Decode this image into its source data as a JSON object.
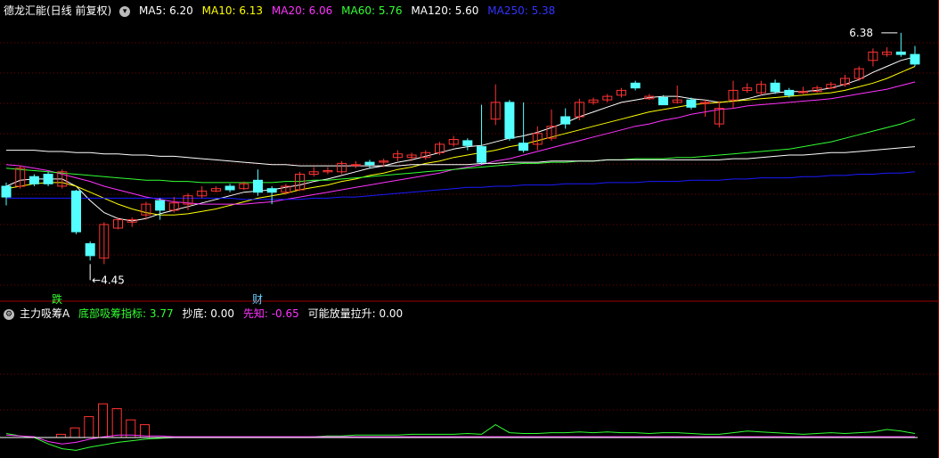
{
  "main_header": {
    "title": "德龙汇能(日线 前复权)",
    "ma": [
      {
        "label": "MA5: 6.20",
        "color": "#ffffff"
      },
      {
        "label": "MA10: 6.13",
        "color": "#ffff00"
      },
      {
        "label": "MA20: 6.06",
        "color": "#ff33ff"
      },
      {
        "label": "MA60: 5.76",
        "color": "#33ff33"
      },
      {
        "label": "MA120: 5.60",
        "color": "#ffffff"
      },
      {
        "label": "MA250: 5.38",
        "color": "#3333ff"
      }
    ]
  },
  "sub_header": {
    "title": "主力吸筹A",
    "items": [
      {
        "label": "底部吸筹指标: 3.77",
        "color": "#33ff33"
      },
      {
        "label": "抄底: 0.00",
        "color": "#ffffff"
      },
      {
        "label": "先知: -0.65",
        "color": "#ff33ff"
      },
      {
        "label": "可能放量拉升: 0.00",
        "color": "#ffffff"
      }
    ]
  },
  "markers": {
    "die": "跌",
    "cai": "财"
  },
  "chart_data": {
    "type": "candlestick",
    "ylim": [
      4.2,
      6.55
    ],
    "annotations": {
      "high": "6.38",
      "low": "4.45"
    },
    "candles": [
      [
        5.01,
        5.1,
        4.94,
        5.13,
        0
      ],
      [
        5.1,
        5.25,
        5.08,
        5.27,
        1
      ],
      [
        5.18,
        5.12,
        5.1,
        5.2,
        0
      ],
      [
        5.12,
        5.2,
        5.1,
        5.22,
        0
      ],
      [
        5.22,
        5.1,
        5.08,
        5.24,
        1
      ],
      [
        5.06,
        4.72,
        4.7,
        5.07,
        0
      ],
      [
        4.62,
        4.52,
        4.48,
        4.64,
        0
      ],
      [
        4.5,
        4.78,
        4.45,
        4.8,
        1
      ],
      [
        4.75,
        4.82,
        4.74,
        4.84,
        1
      ],
      [
        4.82,
        4.8,
        4.76,
        4.84,
        1
      ],
      [
        4.86,
        4.95,
        4.82,
        4.97,
        1
      ],
      [
        4.98,
        4.9,
        4.82,
        5.0,
        0
      ],
      [
        4.9,
        4.96,
        4.88,
        5.01,
        1
      ],
      [
        4.95,
        5.02,
        4.9,
        5.04,
        1
      ],
      [
        5.02,
        5.06,
        5.0,
        5.1,
        1
      ],
      [
        5.06,
        5.08,
        5.05,
        5.1,
        1
      ],
      [
        5.07,
        5.1,
        5.05,
        5.12,
        0
      ],
      [
        5.08,
        5.12,
        5.07,
        5.14,
        1
      ],
      [
        5.15,
        5.05,
        5.02,
        5.24,
        0
      ],
      [
        5.05,
        5.08,
        4.95,
        5.1,
        0
      ],
      [
        5.05,
        5.1,
        5.03,
        5.12,
        1
      ],
      [
        5.07,
        5.2,
        5.06,
        5.22,
        1
      ],
      [
        5.2,
        5.22,
        5.18,
        5.26,
        1
      ],
      [
        5.22,
        5.23,
        5.2,
        5.26,
        1
      ],
      [
        5.22,
        5.29,
        5.2,
        5.31,
        1
      ],
      [
        5.28,
        5.28,
        5.25,
        5.31,
        1
      ],
      [
        5.28,
        5.3,
        5.25,
        5.32,
        0
      ],
      [
        5.3,
        5.31,
        5.26,
        5.33,
        1
      ],
      [
        5.34,
        5.37,
        5.31,
        5.4,
        1
      ],
      [
        5.36,
        5.34,
        5.31,
        5.38,
        1
      ],
      [
        5.34,
        5.38,
        5.32,
        5.4,
        1
      ],
      [
        5.38,
        5.45,
        5.36,
        5.47,
        1
      ],
      [
        5.45,
        5.49,
        5.43,
        5.52,
        1
      ],
      [
        5.48,
        5.44,
        5.4,
        5.5,
        0
      ],
      [
        5.43,
        5.3,
        5.28,
        5.78,
        0
      ],
      [
        5.66,
        5.8,
        5.61,
        5.95,
        1
      ],
      [
        5.8,
        5.5,
        5.48,
        5.82,
        0
      ],
      [
        5.4,
        5.46,
        5.38,
        5.8,
        0
      ],
      [
        5.45,
        5.54,
        5.4,
        5.6,
        1
      ],
      [
        5.5,
        5.6,
        5.48,
        5.74,
        1
      ],
      [
        5.62,
        5.68,
        5.58,
        5.75,
        0
      ],
      [
        5.68,
        5.8,
        5.65,
        5.83,
        1
      ],
      [
        5.8,
        5.82,
        5.78,
        5.84,
        1
      ],
      [
        5.82,
        5.85,
        5.8,
        5.87,
        1
      ],
      [
        5.86,
        5.9,
        5.84,
        5.92,
        1
      ],
      [
        5.96,
        5.92,
        5.9,
        5.98,
        0
      ],
      [
        5.85,
        5.83,
        5.82,
        5.87,
        1
      ],
      [
        5.84,
        5.78,
        5.78,
        5.86,
        0
      ],
      [
        5.8,
        5.82,
        5.79,
        5.94,
        1
      ],
      [
        5.82,
        5.76,
        5.74,
        5.84,
        0
      ],
      [
        5.79,
        5.8,
        5.68,
        5.82,
        1
      ],
      [
        5.75,
        5.62,
        5.59,
        5.81,
        1
      ],
      [
        5.82,
        5.9,
        5.75,
        5.98,
        1
      ],
      [
        5.9,
        5.92,
        5.88,
        5.96,
        1
      ],
      [
        5.88,
        5.95,
        5.86,
        5.98,
        1
      ],
      [
        5.96,
        5.89,
        5.87,
        5.99,
        0
      ],
      [
        5.9,
        5.86,
        5.84,
        5.92,
        0
      ],
      [
        5.88,
        5.89,
        5.87,
        5.93,
        1
      ],
      [
        5.89,
        5.92,
        5.88,
        5.94,
        1
      ],
      [
        5.92,
        5.95,
        5.91,
        5.97,
        1
      ],
      [
        5.95,
        6.0,
        5.93,
        6.03,
        1
      ],
      [
        6.0,
        6.08,
        5.98,
        6.1,
        1
      ],
      [
        6.15,
        6.22,
        6.1,
        6.25,
        1
      ],
      [
        6.2,
        6.22,
        6.18,
        6.26,
        1
      ],
      [
        6.22,
        6.2,
        6.18,
        6.38,
        0
      ],
      [
        6.2,
        6.12,
        6.1,
        6.27,
        0
      ]
    ],
    "ma_lines": [
      {
        "name": "MA5",
        "color": "#ffffff",
        "values": [
          5.1,
          5.15,
          5.16,
          5.16,
          5.16,
          5.1,
          4.98,
          4.88,
          4.83,
          4.81,
          4.83,
          4.87,
          4.9,
          4.93,
          4.96,
          4.99,
          5.02,
          5.05,
          5.06,
          5.07,
          5.09,
          5.11,
          5.14,
          5.16,
          5.19,
          5.22,
          5.25,
          5.27,
          5.3,
          5.32,
          5.35,
          5.38,
          5.41,
          5.43,
          5.44,
          5.47,
          5.5,
          5.52,
          5.55,
          5.59,
          5.63,
          5.68,
          5.72,
          5.76,
          5.8,
          5.82,
          5.84,
          5.85,
          5.85,
          5.83,
          5.82,
          5.8,
          5.81,
          5.83,
          5.86,
          5.88,
          5.89,
          5.89,
          5.9,
          5.92,
          5.95,
          5.99,
          6.05,
          6.1,
          6.15,
          6.18
        ]
      },
      {
        "name": "MA10",
        "color": "#ffff00",
        "values": [
          5.08,
          5.1,
          5.12,
          5.13,
          5.13,
          5.1,
          5.05,
          5.0,
          4.95,
          4.91,
          4.88,
          4.86,
          4.86,
          4.87,
          4.89,
          4.91,
          4.94,
          4.97,
          5.0,
          5.02,
          5.04,
          5.07,
          5.09,
          5.11,
          5.14,
          5.16,
          5.19,
          5.21,
          5.24,
          5.26,
          5.29,
          5.31,
          5.34,
          5.36,
          5.38,
          5.4,
          5.43,
          5.45,
          5.48,
          5.51,
          5.54,
          5.57,
          5.6,
          5.63,
          5.66,
          5.69,
          5.72,
          5.74,
          5.76,
          5.78,
          5.79,
          5.8,
          5.81,
          5.82,
          5.83,
          5.84,
          5.85,
          5.86,
          5.87,
          5.88,
          5.9,
          5.93,
          5.96,
          6.0,
          6.05,
          6.1
        ]
      },
      {
        "name": "MA20",
        "color": "#ff33ff",
        "values": [
          5.28,
          5.27,
          5.25,
          5.23,
          5.2,
          5.17,
          5.14,
          5.1,
          5.07,
          5.04,
          5.01,
          4.99,
          4.97,
          4.96,
          4.95,
          4.95,
          4.95,
          4.95,
          4.96,
          4.97,
          4.99,
          5.01,
          5.03,
          5.05,
          5.07,
          5.09,
          5.11,
          5.13,
          5.15,
          5.17,
          5.19,
          5.21,
          5.24,
          5.26,
          5.28,
          5.31,
          5.33,
          5.36,
          5.39,
          5.42,
          5.45,
          5.48,
          5.51,
          5.54,
          5.57,
          5.6,
          5.62,
          5.65,
          5.67,
          5.7,
          5.72,
          5.74,
          5.75,
          5.77,
          5.78,
          5.79,
          5.8,
          5.81,
          5.82,
          5.83,
          5.85,
          5.87,
          5.89,
          5.91,
          5.94,
          5.97
        ]
      },
      {
        "name": "MA60",
        "color": "#33ff33",
        "values": [
          5.25,
          5.24,
          5.23,
          5.22,
          5.21,
          5.2,
          5.19,
          5.18,
          5.17,
          5.16,
          5.15,
          5.15,
          5.14,
          5.14,
          5.13,
          5.13,
          5.13,
          5.13,
          5.13,
          5.13,
          5.14,
          5.14,
          5.15,
          5.15,
          5.16,
          5.17,
          5.18,
          5.19,
          5.2,
          5.21,
          5.22,
          5.23,
          5.24,
          5.25,
          5.26,
          5.27,
          5.28,
          5.29,
          5.29,
          5.3,
          5.3,
          5.31,
          5.31,
          5.32,
          5.32,
          5.33,
          5.33,
          5.33,
          5.34,
          5.34,
          5.35,
          5.36,
          5.37,
          5.38,
          5.39,
          5.4,
          5.41,
          5.43,
          5.45,
          5.47,
          5.5,
          5.53,
          5.56,
          5.59,
          5.62,
          5.66
        ]
      },
      {
        "name": "MA120",
        "color": "#ffffff",
        "values": [
          5.4,
          5.4,
          5.4,
          5.39,
          5.39,
          5.38,
          5.38,
          5.37,
          5.37,
          5.36,
          5.36,
          5.35,
          5.35,
          5.34,
          5.33,
          5.32,
          5.31,
          5.3,
          5.29,
          5.28,
          5.28,
          5.27,
          5.27,
          5.27,
          5.27,
          5.27,
          5.27,
          5.27,
          5.27,
          5.28,
          5.28,
          5.28,
          5.28,
          5.28,
          5.29,
          5.29,
          5.3,
          5.3,
          5.3,
          5.31,
          5.31,
          5.31,
          5.31,
          5.32,
          5.32,
          5.32,
          5.32,
          5.32,
          5.32,
          5.32,
          5.32,
          5.32,
          5.33,
          5.33,
          5.34,
          5.35,
          5.36,
          5.36,
          5.37,
          5.38,
          5.38,
          5.39,
          5.4,
          5.41,
          5.42,
          5.43
        ]
      },
      {
        "name": "MA250",
        "color": "#1a1aff",
        "values": [
          5.0,
          5.0,
          5.0,
          5.0,
          5.0,
          5.0,
          5.0,
          5.0,
          5.0,
          5.0,
          5.0,
          5.0,
          5.0,
          5.0,
          5.0,
          5.0,
          5.0,
          4.99,
          4.99,
          4.99,
          4.99,
          4.99,
          5.0,
          5.0,
          5.01,
          5.01,
          5.02,
          5.03,
          5.04,
          5.05,
          5.06,
          5.07,
          5.08,
          5.09,
          5.09,
          5.1,
          5.1,
          5.11,
          5.11,
          5.11,
          5.12,
          5.12,
          5.12,
          5.13,
          5.13,
          5.13,
          5.14,
          5.14,
          5.14,
          5.15,
          5.15,
          5.15,
          5.16,
          5.16,
          5.17,
          5.17,
          5.17,
          5.18,
          5.18,
          5.19,
          5.19,
          5.2,
          5.2,
          5.21,
          5.21,
          5.22
        ]
      }
    ],
    "sub_bars": [
      0,
      0,
      0,
      0,
      0,
      0,
      0,
      0,
      0,
      0,
      0,
      0,
      0,
      0,
      0,
      0,
      0,
      0,
      0,
      0,
      0,
      0,
      0,
      0,
      0,
      0,
      0,
      0,
      0,
      0,
      0,
      0,
      0,
      0,
      0,
      0,
      0,
      0,
      0,
      0,
      0,
      0,
      0,
      0,
      0,
      0,
      0,
      0,
      0,
      0,
      0,
      0,
      0,
      0,
      0,
      0,
      0,
      0,
      0,
      0,
      0,
      0,
      0,
      0,
      0,
      0
    ],
    "sub_bars_early": [
      0,
      0,
      0.4,
      1.2,
      2.6,
      4.2,
      3.6,
      2.2,
      1.6
    ],
    "indicator_green": [
      0.5,
      0.2,
      0,
      -0.8,
      -1.4,
      -1.6,
      -1.2,
      -0.9,
      -0.6,
      -0.4,
      -0.2,
      -0.1,
      0,
      0,
      0,
      0,
      0,
      0,
      0,
      0,
      0,
      0,
      0.1,
      0.2,
      0.2,
      0.3,
      0.3,
      0.3,
      0.3,
      0.4,
      0.4,
      0.4,
      0.4,
      0.5,
      0.4,
      1.6,
      0.6,
      0.5,
      0.5,
      0.6,
      0.6,
      0.7,
      0.6,
      0.7,
      0.6,
      0.6,
      0.5,
      0.6,
      0.6,
      0.5,
      0.4,
      0.4,
      0.6,
      0.8,
      0.7,
      0.6,
      0.5,
      0.4,
      0.5,
      0.6,
      0.5,
      0.6,
      0.7,
      1.0,
      0.8,
      0.5
    ],
    "indicator_magenta": [
      0.3,
      0.2,
      0.1,
      -0.5,
      -0.8,
      -0.6,
      -0.2,
      0.1,
      0.3,
      0.3,
      0.2,
      0.2,
      0.1,
      0.1,
      0.1,
      0.1,
      0.1,
      0.1,
      0.1,
      0.1,
      0.1,
      0.1,
      0.1,
      0.1,
      0.1,
      0.1,
      0.1,
      0.1,
      0.1,
      0.1,
      0.1,
      0.1,
      0.1,
      0.1,
      0.1,
      0.1,
      0.1,
      0.1,
      0.1,
      0.1,
      0.1,
      0.1,
      0.1,
      0.1,
      0.1,
      0.1,
      0.1,
      0.1,
      0.1,
      0.1,
      0.1,
      0.1,
      0.1,
      0.1,
      0.1,
      0.1,
      0.1,
      0.1,
      0.1,
      0.1,
      0.1,
      0.1,
      0.1,
      0.1,
      0.1,
      0.1
    ]
  }
}
